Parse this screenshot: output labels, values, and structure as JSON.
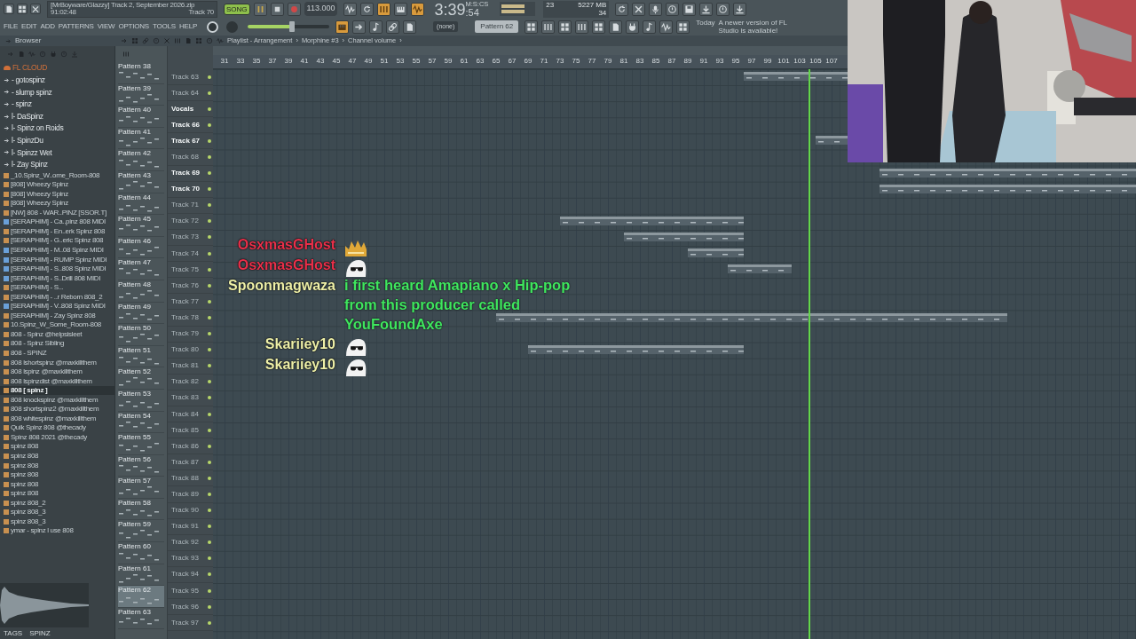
{
  "hint_bar": {
    "text": "[MrBoyware/Glazzy] Track 2, September 2026.zip",
    "time": "91:02:48",
    "track": "Track 70"
  },
  "transport": {
    "mode": "SONG",
    "song_mode": true,
    "tempo": "113.000"
  },
  "mode_buttons": [
    {
      "on": false
    },
    {
      "on": false
    },
    {
      "on": true
    },
    {
      "on": false
    },
    {
      "on": true
    }
  ],
  "clock": {
    "time": "3:39",
    "sub": ":54",
    "unit": "M:S:CS"
  },
  "cpu": {
    "cpu": "23",
    "memory": "5227 MB",
    "polyphony": "34"
  },
  "right_buttons": [
    {
      "on": false
    },
    {
      "on": false
    },
    {
      "on": false
    },
    {
      "on": false
    },
    {
      "on": false
    },
    {
      "on": false
    },
    {
      "on": false
    },
    {
      "on": false
    }
  ],
  "menu": [
    "FILE",
    "EDIT",
    "ADD",
    "PATTERNS",
    "VIEW",
    "OPTIONS",
    "TOOLS",
    "HELP"
  ],
  "master_pitch": {
    "level": 0.54
  },
  "tool_buttons": [
    {
      "on": true
    },
    {
      "on": false
    },
    {
      "on": false
    },
    {
      "on": false
    },
    {
      "on": false
    }
  ],
  "pattern_picker": {
    "preset": "(none)",
    "pattern": "Pattern 62"
  },
  "window_buttons": [
    {
      "on": false
    },
    {
      "on": false
    },
    {
      "on": false
    },
    {
      "on": false
    },
    {
      "on": false
    },
    {
      "on": false
    },
    {
      "on": false
    },
    {
      "on": false
    },
    {
      "on": false
    },
    {
      "on": false
    }
  ],
  "news": {
    "day": "Today",
    "text": "A newer version of FL Studio is available!"
  },
  "browser": {
    "title": "Browser",
    "root": "FL CLOUD",
    "items": [
      {
        "kind": "folder",
        "name": "- gotospinz",
        "selected": false
      },
      {
        "kind": "folder",
        "name": "- slump spinz",
        "selected": false
      },
      {
        "kind": "folder",
        "name": "- spinz",
        "selected": false
      },
      {
        "kind": "folder",
        "name": "l- DaSpinz",
        "selected": false
      },
      {
        "kind": "folder",
        "name": "l- Spinz on Roids",
        "selected": false
      },
      {
        "kind": "folder",
        "name": "l- SpinzDu",
        "selected": false
      },
      {
        "kind": "folder",
        "name": "l- Spinzz Wet",
        "selected": false
      },
      {
        "kind": "folder",
        "name": "l- Zay Spinz",
        "selected": false
      },
      {
        "kind": "audio",
        "name": "_10.Spinz_W..ome_Room-808",
        "selected": false
      },
      {
        "kind": "audio",
        "name": "[808] Wheezy Spinz",
        "selected": false
      },
      {
        "kind": "audio",
        "name": "[808] Wheezy Spinz",
        "selected": false
      },
      {
        "kind": "audio",
        "name": "[808] Wheezy Spinz",
        "selected": false
      },
      {
        "kind": "audio",
        "name": "[NW] 808 - WAR..PINZ [SSOR.T]",
        "selected": false
      },
      {
        "kind": "midi",
        "name": "[SERAPHIM] - Ca..pinz 808 MIDI",
        "selected": false
      },
      {
        "kind": "audio",
        "name": "[SERAPHIM] - En..erk Spinz 808",
        "selected": false
      },
      {
        "kind": "audio",
        "name": "[SERAPHIM] - G..eric Spinz 808",
        "selected": false
      },
      {
        "kind": "midi",
        "name": "[SERAPHIM] - M..08 Spinz MIDI",
        "selected": false
      },
      {
        "kind": "midi",
        "name": "[SERAPHIM] - RUMP Spinz MIDI",
        "selected": false
      },
      {
        "kind": "midi",
        "name": "[SERAPHIM] - S..808 Spinz MIDI",
        "selected": false
      },
      {
        "kind": "midi",
        "name": "[SERAPHIM] - S..Drill 808 MIDI",
        "selected": false
      },
      {
        "kind": "audio",
        "name": "[SERAPHIM] - S...",
        "selected": false
      },
      {
        "kind": "audio",
        "name": "[SERAPHIM] - ..r Reborn 808_2",
        "selected": false
      },
      {
        "kind": "midi",
        "name": "[SERAPHIM] - V..808 Spinz MIDI",
        "selected": false
      },
      {
        "kind": "audio",
        "name": "[SERAPHIM] - Zay Spinz 808",
        "selected": false
      },
      {
        "kind": "audio",
        "name": "10.Spinz_W_Some_Room-808",
        "selected": false
      },
      {
        "kind": "audio",
        "name": "808 - Spinz @helpsisleet",
        "selected": false
      },
      {
        "kind": "audio",
        "name": "808 - Spinz Sibling",
        "selected": false
      },
      {
        "kind": "audio",
        "name": "808 - SPINZ",
        "selected": false
      },
      {
        "kind": "audio",
        "name": "808 lshortspinz @maxkillthem",
        "selected": false
      },
      {
        "kind": "audio",
        "name": "808 lspinz @maxkillthem",
        "selected": false
      },
      {
        "kind": "audio",
        "name": "808 lspinzdist @maxkillthem",
        "selected": false
      },
      {
        "kind": "audio",
        "name": "808 [ spinz ]",
        "selected": true
      },
      {
        "kind": "audio",
        "name": "808 knockspinz @maxkillthem",
        "selected": false
      },
      {
        "kind": "audio",
        "name": "808 shortspinz2 @maxkillthem",
        "selected": false
      },
      {
        "kind": "audio",
        "name": "808 whitespinz @maxkillthem",
        "selected": false
      },
      {
        "kind": "audio",
        "name": "Quik Spinz 808 @thecady",
        "selected": false
      },
      {
        "kind": "audio",
        "name": "Spinz 808 2021 @thecady",
        "selected": false
      },
      {
        "kind": "audio",
        "name": "spinz 808",
        "selected": false
      },
      {
        "kind": "audio",
        "name": "spinz 808",
        "selected": false
      },
      {
        "kind": "audio",
        "name": "spinz 808",
        "selected": false
      },
      {
        "kind": "audio",
        "name": "spinz 808",
        "selected": false
      },
      {
        "kind": "audio",
        "name": "spinz 808",
        "selected": false
      },
      {
        "kind": "audio",
        "name": "spinz 808",
        "selected": false
      },
      {
        "kind": "audio",
        "name": "spinz 808_2",
        "selected": false
      },
      {
        "kind": "audio",
        "name": "spinz 808_3",
        "selected": false
      },
      {
        "kind": "audio",
        "name": "spinz 808_3",
        "selected": false
      },
      {
        "kind": "audio",
        "name": "ymar - spinz l use 808",
        "selected": false
      }
    ],
    "tabs": [
      "TAGS",
      "SPINZ"
    ]
  },
  "patterns": [
    {
      "name": "Pattern 38",
      "selected": false
    },
    {
      "name": "Pattern 39",
      "selected": false
    },
    {
      "name": "Pattern 40",
      "selected": false
    },
    {
      "name": "Pattern 41",
      "selected": false
    },
    {
      "name": "Pattern 42",
      "selected": false
    },
    {
      "name": "Pattern 43",
      "selected": false
    },
    {
      "name": "Pattern 44",
      "selected": false
    },
    {
      "name": "Pattern 45",
      "selected": false
    },
    {
      "name": "Pattern 46",
      "selected": false
    },
    {
      "name": "Pattern 47",
      "selected": false
    },
    {
      "name": "Pattern 48",
      "selected": false
    },
    {
      "name": "Pattern 49",
      "selected": false
    },
    {
      "name": "Pattern 50",
      "selected": false
    },
    {
      "name": "Pattern 51",
      "selected": false
    },
    {
      "name": "Pattern 52",
      "selected": false
    },
    {
      "name": "Pattern 53",
      "selected": false
    },
    {
      "name": "Pattern 54",
      "selected": false
    },
    {
      "name": "Pattern 55",
      "selected": false
    },
    {
      "name": "Pattern 56",
      "selected": false
    },
    {
      "name": "Pattern 57",
      "selected": false
    },
    {
      "name": "Pattern 58",
      "selected": false
    },
    {
      "name": "Pattern 59",
      "selected": false
    },
    {
      "name": "Pattern 60",
      "selected": false
    },
    {
      "name": "Pattern 61",
      "selected": false
    },
    {
      "name": "Pattern 62",
      "selected": true
    },
    {
      "name": "Pattern 63",
      "selected": false
    }
  ],
  "playlist": {
    "breadcrumb": [
      "Playlist - Arrangement",
      "›",
      "Morphine #3",
      "›",
      "Channel volume",
      "›"
    ],
    "ruler": [
      "31",
      "33",
      "35",
      "37",
      "39",
      "41",
      "43",
      "45",
      "47",
      "49",
      "51",
      "53",
      "55",
      "57",
      "59",
      "61",
      "63",
      "65",
      "67",
      "69",
      "71",
      "73",
      "75",
      "77",
      "79",
      "81",
      "83",
      "85",
      "87",
      "89",
      "91",
      "93",
      "95",
      "97",
      "99",
      "101",
      "103",
      "105",
      "107"
    ],
    "playhead": {
      "level": 0.645
    },
    "tracks": [
      {
        "name": "Track 63",
        "faded": true,
        "clips": [
          {
            "kind": "pattern"
          }
        ]
      },
      {
        "name": "Track 64",
        "faded": true
      },
      {
        "name": "Vocals",
        "faded": false
      },
      {
        "name": "Track 66",
        "faded": false
      },
      {
        "name": "Track 67",
        "faded": false,
        "clips": [
          {
            "kind": "pattern"
          }
        ]
      },
      {
        "name": "Track 68",
        "faded": true
      },
      {
        "name": "Track 69",
        "faded": false,
        "clips": [
          {
            "kind": "pattern"
          }
        ]
      },
      {
        "name": "Track 70",
        "faded": false,
        "clips": [
          {
            "kind": "pattern"
          }
        ]
      },
      {
        "name": "Track 71",
        "faded": true
      },
      {
        "name": "Track 72",
        "faded": true,
        "clips": [
          {
            "kind": "pattern"
          }
        ]
      },
      {
        "name": "Track 73",
        "faded": true,
        "clips": [
          {
            "kind": "pattern"
          }
        ]
      },
      {
        "name": "Track 74",
        "faded": true,
        "clips": [
          {
            "kind": "pattern"
          }
        ]
      },
      {
        "name": "Track 75",
        "faded": true,
        "clips": [
          {
            "kind": "pattern"
          }
        ]
      },
      {
        "name": "Track 76",
        "faded": true
      },
      {
        "name": "Track 77",
        "faded": true
      },
      {
        "name": "Track 78",
        "faded": true,
        "clips": [
          {
            "kind": "pattern"
          }
        ]
      },
      {
        "name": "Track 79",
        "faded": true
      },
      {
        "name": "Track 80",
        "faded": true,
        "clips": [
          {
            "kind": "pattern"
          }
        ]
      },
      {
        "name": "Track 81",
        "faded": true
      },
      {
        "name": "Track 82",
        "faded": true
      },
      {
        "name": "Track 83",
        "faded": true
      },
      {
        "name": "Track 84",
        "faded": true
      },
      {
        "name": "Track 85",
        "faded": true
      },
      {
        "name": "Track 86",
        "faded": true
      },
      {
        "name": "Track 87",
        "faded": true
      },
      {
        "name": "Track 88",
        "faded": true
      },
      {
        "name": "Track 89",
        "faded": true
      },
      {
        "name": "Track 90",
        "faded": true
      },
      {
        "name": "Track 91",
        "faded": true
      },
      {
        "name": "Track 92",
        "faded": true
      },
      {
        "name": "Track 93",
        "faded": true
      },
      {
        "name": "Track 94",
        "faded": true
      },
      {
        "name": "Track 95",
        "faded": true
      },
      {
        "name": "Track 96",
        "faded": true
      },
      {
        "name": "Track 97",
        "faded": true
      }
    ]
  },
  "chat": [
    {
      "user": "OsxmasGHost",
      "color": "#e8304a",
      "kind": "crown"
    },
    {
      "user": "OsxmasGHost",
      "color": "#e8304a",
      "kind": "ghost"
    },
    {
      "user": "Spoonmagwaza",
      "color": "#eef0a8",
      "kind": "message",
      "text": "i first heard Amapiano x Hip-pop from this producer called YouFoundAxe"
    },
    {
      "user": "Skariiey10",
      "color": "#eef0a8",
      "kind": "ghost"
    },
    {
      "user": "Skariiey10",
      "color": "#eef0a8",
      "kind": "ghost"
    }
  ]
}
